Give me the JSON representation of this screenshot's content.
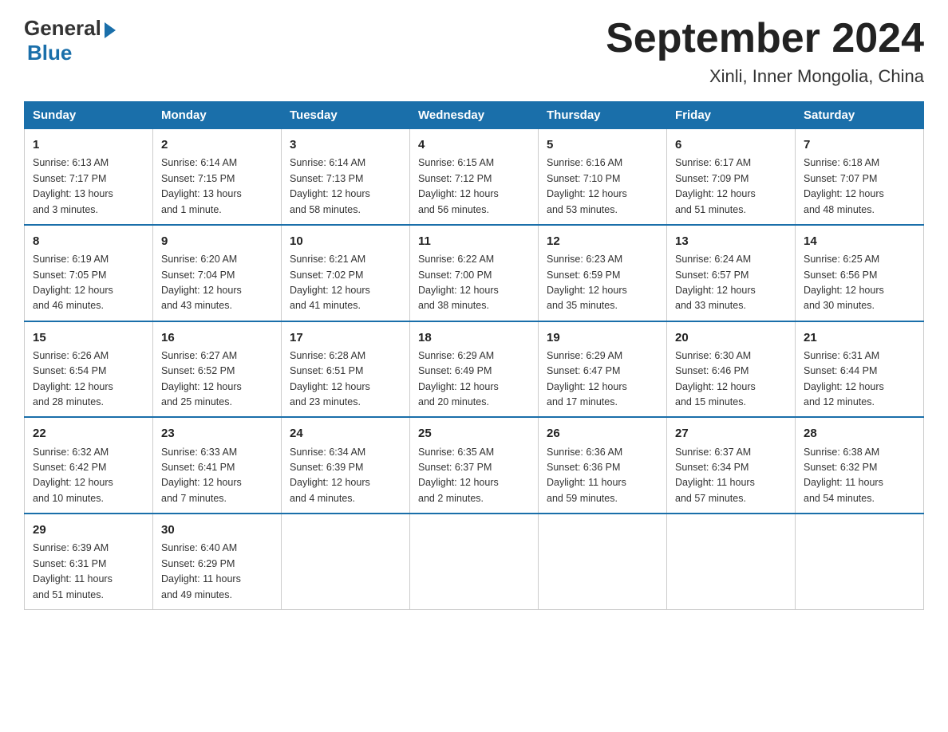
{
  "logo": {
    "general": "General",
    "blue": "Blue"
  },
  "title": "September 2024",
  "location": "Xinli, Inner Mongolia, China",
  "days_of_week": [
    "Sunday",
    "Monday",
    "Tuesday",
    "Wednesday",
    "Thursday",
    "Friday",
    "Saturday"
  ],
  "weeks": [
    [
      {
        "day": "1",
        "info": "Sunrise: 6:13 AM\nSunset: 7:17 PM\nDaylight: 13 hours\nand 3 minutes."
      },
      {
        "day": "2",
        "info": "Sunrise: 6:14 AM\nSunset: 7:15 PM\nDaylight: 13 hours\nand 1 minute."
      },
      {
        "day": "3",
        "info": "Sunrise: 6:14 AM\nSunset: 7:13 PM\nDaylight: 12 hours\nand 58 minutes."
      },
      {
        "day": "4",
        "info": "Sunrise: 6:15 AM\nSunset: 7:12 PM\nDaylight: 12 hours\nand 56 minutes."
      },
      {
        "day": "5",
        "info": "Sunrise: 6:16 AM\nSunset: 7:10 PM\nDaylight: 12 hours\nand 53 minutes."
      },
      {
        "day": "6",
        "info": "Sunrise: 6:17 AM\nSunset: 7:09 PM\nDaylight: 12 hours\nand 51 minutes."
      },
      {
        "day": "7",
        "info": "Sunrise: 6:18 AM\nSunset: 7:07 PM\nDaylight: 12 hours\nand 48 minutes."
      }
    ],
    [
      {
        "day": "8",
        "info": "Sunrise: 6:19 AM\nSunset: 7:05 PM\nDaylight: 12 hours\nand 46 minutes."
      },
      {
        "day": "9",
        "info": "Sunrise: 6:20 AM\nSunset: 7:04 PM\nDaylight: 12 hours\nand 43 minutes."
      },
      {
        "day": "10",
        "info": "Sunrise: 6:21 AM\nSunset: 7:02 PM\nDaylight: 12 hours\nand 41 minutes."
      },
      {
        "day": "11",
        "info": "Sunrise: 6:22 AM\nSunset: 7:00 PM\nDaylight: 12 hours\nand 38 minutes."
      },
      {
        "day": "12",
        "info": "Sunrise: 6:23 AM\nSunset: 6:59 PM\nDaylight: 12 hours\nand 35 minutes."
      },
      {
        "day": "13",
        "info": "Sunrise: 6:24 AM\nSunset: 6:57 PM\nDaylight: 12 hours\nand 33 minutes."
      },
      {
        "day": "14",
        "info": "Sunrise: 6:25 AM\nSunset: 6:56 PM\nDaylight: 12 hours\nand 30 minutes."
      }
    ],
    [
      {
        "day": "15",
        "info": "Sunrise: 6:26 AM\nSunset: 6:54 PM\nDaylight: 12 hours\nand 28 minutes."
      },
      {
        "day": "16",
        "info": "Sunrise: 6:27 AM\nSunset: 6:52 PM\nDaylight: 12 hours\nand 25 minutes."
      },
      {
        "day": "17",
        "info": "Sunrise: 6:28 AM\nSunset: 6:51 PM\nDaylight: 12 hours\nand 23 minutes."
      },
      {
        "day": "18",
        "info": "Sunrise: 6:29 AM\nSunset: 6:49 PM\nDaylight: 12 hours\nand 20 minutes."
      },
      {
        "day": "19",
        "info": "Sunrise: 6:29 AM\nSunset: 6:47 PM\nDaylight: 12 hours\nand 17 minutes."
      },
      {
        "day": "20",
        "info": "Sunrise: 6:30 AM\nSunset: 6:46 PM\nDaylight: 12 hours\nand 15 minutes."
      },
      {
        "day": "21",
        "info": "Sunrise: 6:31 AM\nSunset: 6:44 PM\nDaylight: 12 hours\nand 12 minutes."
      }
    ],
    [
      {
        "day": "22",
        "info": "Sunrise: 6:32 AM\nSunset: 6:42 PM\nDaylight: 12 hours\nand 10 minutes."
      },
      {
        "day": "23",
        "info": "Sunrise: 6:33 AM\nSunset: 6:41 PM\nDaylight: 12 hours\nand 7 minutes."
      },
      {
        "day": "24",
        "info": "Sunrise: 6:34 AM\nSunset: 6:39 PM\nDaylight: 12 hours\nand 4 minutes."
      },
      {
        "day": "25",
        "info": "Sunrise: 6:35 AM\nSunset: 6:37 PM\nDaylight: 12 hours\nand 2 minutes."
      },
      {
        "day": "26",
        "info": "Sunrise: 6:36 AM\nSunset: 6:36 PM\nDaylight: 11 hours\nand 59 minutes."
      },
      {
        "day": "27",
        "info": "Sunrise: 6:37 AM\nSunset: 6:34 PM\nDaylight: 11 hours\nand 57 minutes."
      },
      {
        "day": "28",
        "info": "Sunrise: 6:38 AM\nSunset: 6:32 PM\nDaylight: 11 hours\nand 54 minutes."
      }
    ],
    [
      {
        "day": "29",
        "info": "Sunrise: 6:39 AM\nSunset: 6:31 PM\nDaylight: 11 hours\nand 51 minutes."
      },
      {
        "day": "30",
        "info": "Sunrise: 6:40 AM\nSunset: 6:29 PM\nDaylight: 11 hours\nand 49 minutes."
      },
      {
        "day": "",
        "info": ""
      },
      {
        "day": "",
        "info": ""
      },
      {
        "day": "",
        "info": ""
      },
      {
        "day": "",
        "info": ""
      },
      {
        "day": "",
        "info": ""
      }
    ]
  ]
}
